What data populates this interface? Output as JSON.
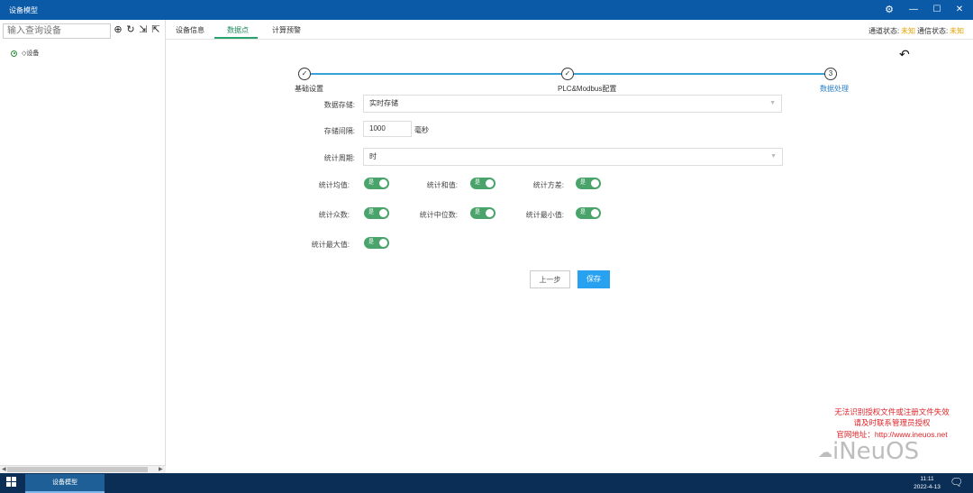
{
  "window": {
    "title": "设备模型"
  },
  "left_panel": {
    "search_placeholder": "输入查询设备",
    "tree_root": "设备"
  },
  "tabs": [
    {
      "label": "设备信息",
      "active": false
    },
    {
      "label": "数据点",
      "active": true
    },
    {
      "label": "计算预警",
      "active": false
    }
  ],
  "status": {
    "channel_label": "通道状态:",
    "channel_value": "未知",
    "comm_label": "通信状态:",
    "comm_value": "未知"
  },
  "steps": [
    {
      "label": "基础设置",
      "marker": "✓"
    },
    {
      "label": "PLC&Modbus配置",
      "marker": "✓"
    },
    {
      "label": "数据处理",
      "marker": "3"
    }
  ],
  "form": {
    "storage_label": "数据存储:",
    "storage_value": "实时存储",
    "interval_label": "存储间隔:",
    "interval_value": "1000",
    "interval_unit": "毫秒",
    "period_label": "统计周期:",
    "period_value": "时",
    "toggles": [
      {
        "label": "统计均值:",
        "value": "是"
      },
      {
        "label": "统计和值:",
        "value": "是"
      },
      {
        "label": "统计方差:",
        "value": "是"
      },
      {
        "label": "统计众数:",
        "value": "是"
      },
      {
        "label": "统计中位数:",
        "value": "是"
      },
      {
        "label": "统计最小值:",
        "value": "是"
      },
      {
        "label": "统计最大值:",
        "value": "是"
      }
    ]
  },
  "buttons": {
    "prev": "上一步",
    "save": "保存"
  },
  "warning": {
    "line1": "无法识别授权文件或注册文件失效",
    "line2": "请及时联系管理员授权",
    "line3": "官网地址：http://www.ineuos.net"
  },
  "watermark": "iNeuOS",
  "taskbar": {
    "app_label": "设备模型",
    "time": "11:11",
    "date": "2022-4-13"
  },
  "colors": {
    "accent": "#2aa36f",
    "step_line": "#3aa0dc",
    "save": "#27a1f0",
    "warn": "#e0262a",
    "toggle": "#4aa36b"
  }
}
